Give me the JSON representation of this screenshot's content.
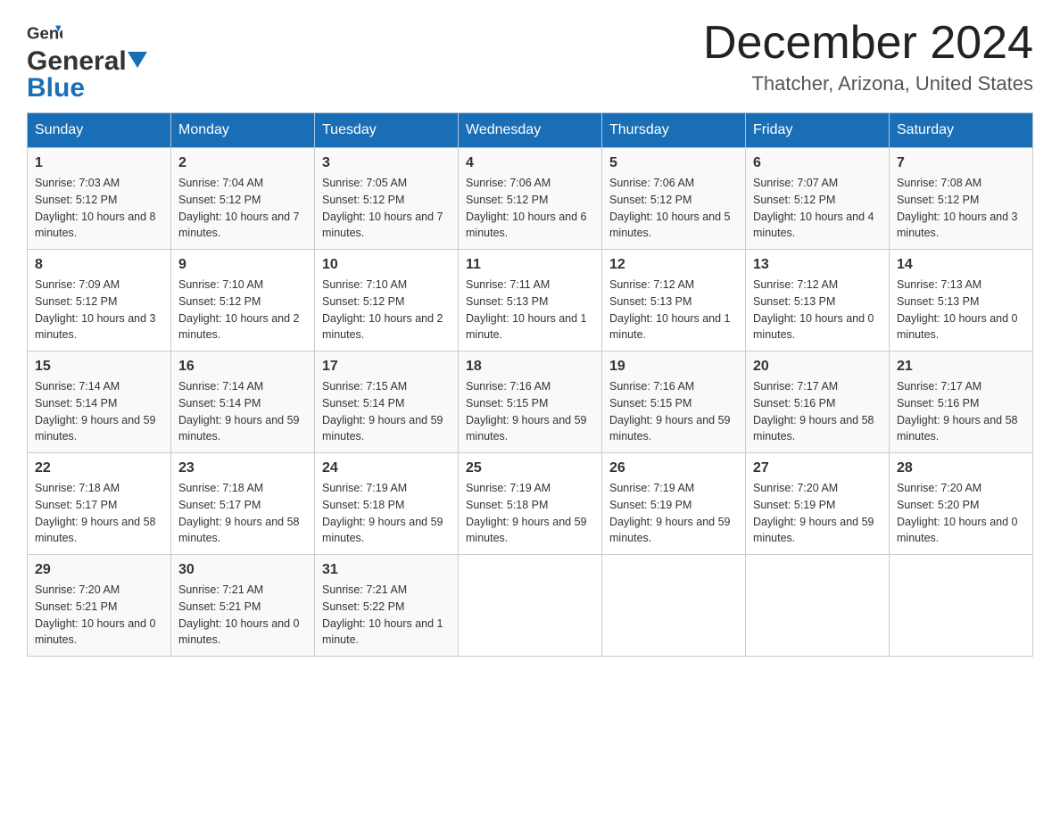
{
  "header": {
    "logo": {
      "general": "General",
      "blue": "Blue",
      "triangle": "▼"
    },
    "title": "December 2024",
    "subtitle": "Thatcher, Arizona, United States"
  },
  "days_of_week": [
    "Sunday",
    "Monday",
    "Tuesday",
    "Wednesday",
    "Thursday",
    "Friday",
    "Saturday"
  ],
  "weeks": [
    [
      {
        "day": "1",
        "sunrise": "Sunrise: 7:03 AM",
        "sunset": "Sunset: 5:12 PM",
        "daylight": "Daylight: 10 hours and 8 minutes."
      },
      {
        "day": "2",
        "sunrise": "Sunrise: 7:04 AM",
        "sunset": "Sunset: 5:12 PM",
        "daylight": "Daylight: 10 hours and 7 minutes."
      },
      {
        "day": "3",
        "sunrise": "Sunrise: 7:05 AM",
        "sunset": "Sunset: 5:12 PM",
        "daylight": "Daylight: 10 hours and 7 minutes."
      },
      {
        "day": "4",
        "sunrise": "Sunrise: 7:06 AM",
        "sunset": "Sunset: 5:12 PM",
        "daylight": "Daylight: 10 hours and 6 minutes."
      },
      {
        "day": "5",
        "sunrise": "Sunrise: 7:06 AM",
        "sunset": "Sunset: 5:12 PM",
        "daylight": "Daylight: 10 hours and 5 minutes."
      },
      {
        "day": "6",
        "sunrise": "Sunrise: 7:07 AM",
        "sunset": "Sunset: 5:12 PM",
        "daylight": "Daylight: 10 hours and 4 minutes."
      },
      {
        "day": "7",
        "sunrise": "Sunrise: 7:08 AM",
        "sunset": "Sunset: 5:12 PM",
        "daylight": "Daylight: 10 hours and 3 minutes."
      }
    ],
    [
      {
        "day": "8",
        "sunrise": "Sunrise: 7:09 AM",
        "sunset": "Sunset: 5:12 PM",
        "daylight": "Daylight: 10 hours and 3 minutes."
      },
      {
        "day": "9",
        "sunrise": "Sunrise: 7:10 AM",
        "sunset": "Sunset: 5:12 PM",
        "daylight": "Daylight: 10 hours and 2 minutes."
      },
      {
        "day": "10",
        "sunrise": "Sunrise: 7:10 AM",
        "sunset": "Sunset: 5:12 PM",
        "daylight": "Daylight: 10 hours and 2 minutes."
      },
      {
        "day": "11",
        "sunrise": "Sunrise: 7:11 AM",
        "sunset": "Sunset: 5:13 PM",
        "daylight": "Daylight: 10 hours and 1 minute."
      },
      {
        "day": "12",
        "sunrise": "Sunrise: 7:12 AM",
        "sunset": "Sunset: 5:13 PM",
        "daylight": "Daylight: 10 hours and 1 minute."
      },
      {
        "day": "13",
        "sunrise": "Sunrise: 7:12 AM",
        "sunset": "Sunset: 5:13 PM",
        "daylight": "Daylight: 10 hours and 0 minutes."
      },
      {
        "day": "14",
        "sunrise": "Sunrise: 7:13 AM",
        "sunset": "Sunset: 5:13 PM",
        "daylight": "Daylight: 10 hours and 0 minutes."
      }
    ],
    [
      {
        "day": "15",
        "sunrise": "Sunrise: 7:14 AM",
        "sunset": "Sunset: 5:14 PM",
        "daylight": "Daylight: 9 hours and 59 minutes."
      },
      {
        "day": "16",
        "sunrise": "Sunrise: 7:14 AM",
        "sunset": "Sunset: 5:14 PM",
        "daylight": "Daylight: 9 hours and 59 minutes."
      },
      {
        "day": "17",
        "sunrise": "Sunrise: 7:15 AM",
        "sunset": "Sunset: 5:14 PM",
        "daylight": "Daylight: 9 hours and 59 minutes."
      },
      {
        "day": "18",
        "sunrise": "Sunrise: 7:16 AM",
        "sunset": "Sunset: 5:15 PM",
        "daylight": "Daylight: 9 hours and 59 minutes."
      },
      {
        "day": "19",
        "sunrise": "Sunrise: 7:16 AM",
        "sunset": "Sunset: 5:15 PM",
        "daylight": "Daylight: 9 hours and 59 minutes."
      },
      {
        "day": "20",
        "sunrise": "Sunrise: 7:17 AM",
        "sunset": "Sunset: 5:16 PM",
        "daylight": "Daylight: 9 hours and 58 minutes."
      },
      {
        "day": "21",
        "sunrise": "Sunrise: 7:17 AM",
        "sunset": "Sunset: 5:16 PM",
        "daylight": "Daylight: 9 hours and 58 minutes."
      }
    ],
    [
      {
        "day": "22",
        "sunrise": "Sunrise: 7:18 AM",
        "sunset": "Sunset: 5:17 PM",
        "daylight": "Daylight: 9 hours and 58 minutes."
      },
      {
        "day": "23",
        "sunrise": "Sunrise: 7:18 AM",
        "sunset": "Sunset: 5:17 PM",
        "daylight": "Daylight: 9 hours and 58 minutes."
      },
      {
        "day": "24",
        "sunrise": "Sunrise: 7:19 AM",
        "sunset": "Sunset: 5:18 PM",
        "daylight": "Daylight: 9 hours and 59 minutes."
      },
      {
        "day": "25",
        "sunrise": "Sunrise: 7:19 AM",
        "sunset": "Sunset: 5:18 PM",
        "daylight": "Daylight: 9 hours and 59 minutes."
      },
      {
        "day": "26",
        "sunrise": "Sunrise: 7:19 AM",
        "sunset": "Sunset: 5:19 PM",
        "daylight": "Daylight: 9 hours and 59 minutes."
      },
      {
        "day": "27",
        "sunrise": "Sunrise: 7:20 AM",
        "sunset": "Sunset: 5:19 PM",
        "daylight": "Daylight: 9 hours and 59 minutes."
      },
      {
        "day": "28",
        "sunrise": "Sunrise: 7:20 AM",
        "sunset": "Sunset: 5:20 PM",
        "daylight": "Daylight: 10 hours and 0 minutes."
      }
    ],
    [
      {
        "day": "29",
        "sunrise": "Sunrise: 7:20 AM",
        "sunset": "Sunset: 5:21 PM",
        "daylight": "Daylight: 10 hours and 0 minutes."
      },
      {
        "day": "30",
        "sunrise": "Sunrise: 7:21 AM",
        "sunset": "Sunset: 5:21 PM",
        "daylight": "Daylight: 10 hours and 0 minutes."
      },
      {
        "day": "31",
        "sunrise": "Sunrise: 7:21 AM",
        "sunset": "Sunset: 5:22 PM",
        "daylight": "Daylight: 10 hours and 1 minute."
      },
      null,
      null,
      null,
      null
    ]
  ]
}
